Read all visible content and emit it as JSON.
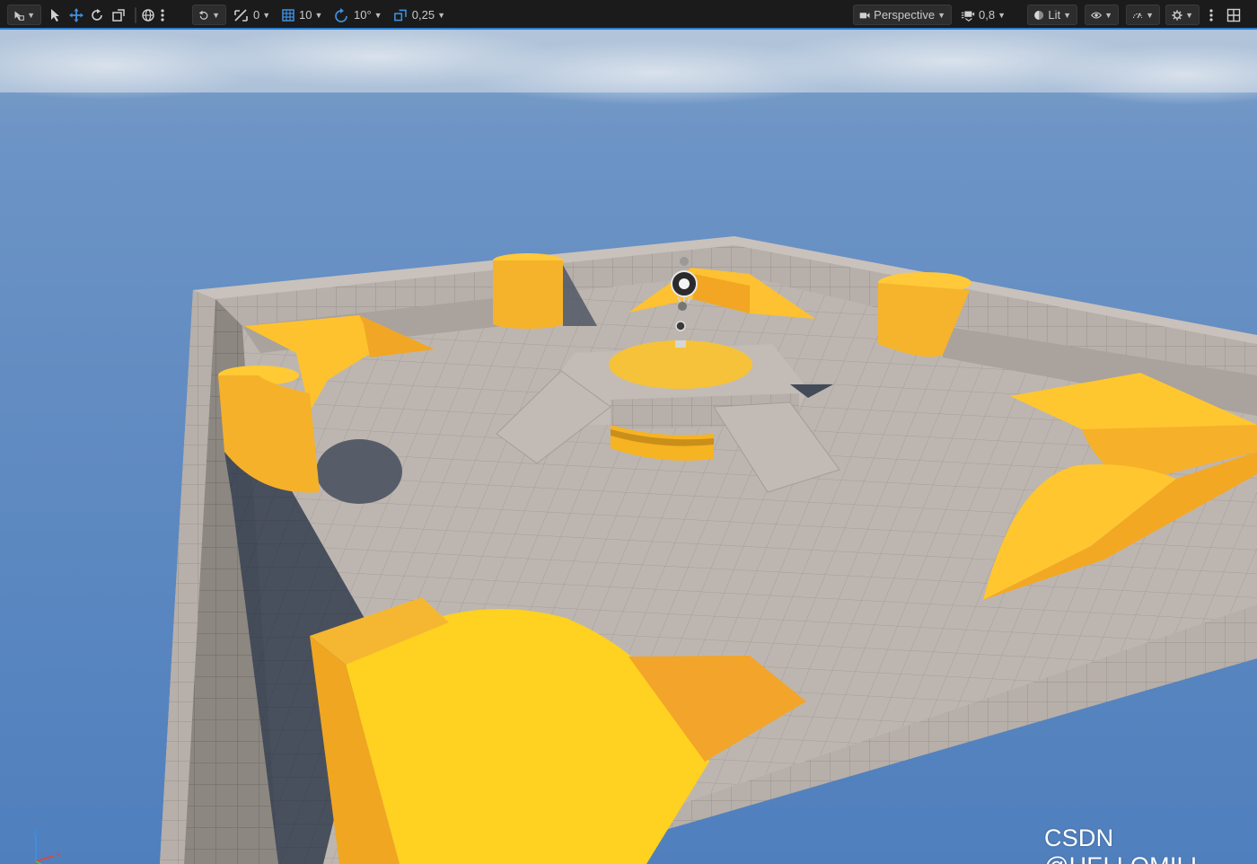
{
  "toolbar": {
    "snap_translate_value": "0",
    "grid_snap_value": "10",
    "rotation_snap_value": "10°",
    "scale_snap_value": "0,25",
    "view_mode_label": "Perspective",
    "camera_speed_value": "0,8",
    "lighting_mode_label": "Lit",
    "accent_color": "#2a7fd4"
  },
  "viewport": {
    "axis_labels": {
      "x": "x",
      "y": "y",
      "z": "z"
    },
    "floor_color": "#bdb6b0",
    "wall_color": "#b4aca6",
    "block_color": "#f9b72a",
    "sky_color": "#5b86bd"
  },
  "watermark": "CSDN @HELLOMILI"
}
